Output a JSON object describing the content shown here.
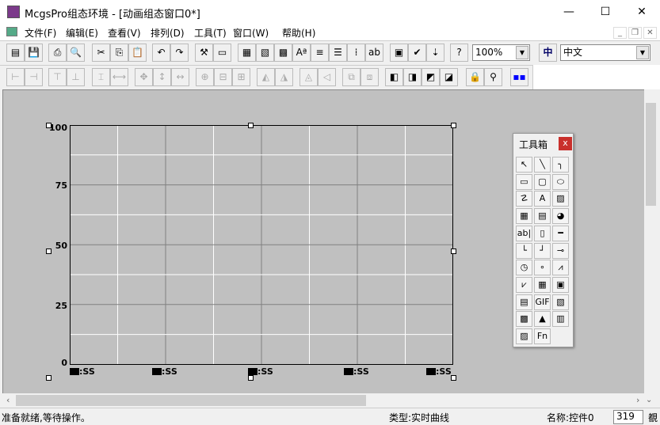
{
  "window": {
    "title": "McgsPro组态环境 - [动画组态窗口0*]",
    "min": "—",
    "max": "☐",
    "close": "✕"
  },
  "menu": [
    "文件(F)",
    "编辑(E)",
    "查看(V)",
    "排列(D)",
    "工具(T)",
    "窗口(W)",
    "帮助(H)"
  ],
  "mdi_controls": [
    "_",
    "❐",
    "✕"
  ],
  "toolbar1": {
    "buttons": [
      {
        "name": "new-window",
        "glyph": "▤"
      },
      {
        "name": "save",
        "glyph": "💾"
      },
      {
        "name": "print",
        "glyph": "⎙"
      },
      {
        "name": "print-preview",
        "glyph": "🔍"
      },
      {
        "name": "cut",
        "glyph": "✂"
      },
      {
        "name": "copy",
        "glyph": "⎘"
      },
      {
        "name": "paste",
        "glyph": "📋"
      },
      {
        "name": "undo",
        "glyph": "↶"
      },
      {
        "name": "redo",
        "glyph": "↷"
      },
      {
        "name": "toolbox",
        "glyph": "⚒"
      },
      {
        "name": "frame",
        "glyph": "▭"
      },
      {
        "name": "fill-color",
        "glyph": "▦"
      },
      {
        "name": "line-color",
        "glyph": "▧"
      },
      {
        "name": "font-color",
        "glyph": "▩"
      },
      {
        "name": "font",
        "glyph": "Aª"
      },
      {
        "name": "line-style",
        "glyph": "≡"
      },
      {
        "name": "align-text",
        "glyph": "☰"
      },
      {
        "name": "grid",
        "glyph": "⁞"
      },
      {
        "name": "text-edit",
        "glyph": "ab"
      },
      {
        "name": "properties",
        "glyph": "▣"
      },
      {
        "name": "check",
        "glyph": "✔"
      },
      {
        "name": "order",
        "glyph": "⇣"
      },
      {
        "name": "help",
        "glyph": "?"
      }
    ],
    "zoom": "100%",
    "lang_icon": "中",
    "language": "中文"
  },
  "toolbar2": {
    "buttons": [
      {
        "name": "align-left",
        "glyph": "⊢"
      },
      {
        "name": "align-right",
        "glyph": "⊣"
      },
      {
        "name": "align-top",
        "glyph": "⊤"
      },
      {
        "name": "align-bottom",
        "glyph": "⊥"
      },
      {
        "name": "center-v",
        "glyph": "⌶"
      },
      {
        "name": "center-h",
        "glyph": "⟷"
      },
      {
        "name": "same-size",
        "glyph": "✥"
      },
      {
        "name": "same-height",
        "glyph": "↕"
      },
      {
        "name": "same-width",
        "glyph": "↔"
      },
      {
        "name": "center-both",
        "glyph": "⊕"
      },
      {
        "name": "center-horiz",
        "glyph": "⊟"
      },
      {
        "name": "center-vert",
        "glyph": "⊞"
      },
      {
        "name": "rotate-left",
        "glyph": "◭"
      },
      {
        "name": "rotate-right",
        "glyph": "◮"
      },
      {
        "name": "flip-h",
        "glyph": "◬"
      },
      {
        "name": "flip-v",
        "glyph": "◁"
      },
      {
        "name": "group",
        "glyph": "⧉"
      },
      {
        "name": "ungroup",
        "glyph": "⧈"
      }
    ],
    "active": [
      {
        "name": "bring-front",
        "glyph": "◧"
      },
      {
        "name": "send-back",
        "glyph": "◨"
      },
      {
        "name": "forward",
        "glyph": "◩"
      },
      {
        "name": "backward",
        "glyph": "◪"
      },
      {
        "name": "lock",
        "glyph": "🔒"
      },
      {
        "name": "anchor",
        "glyph": "⚲"
      },
      {
        "name": "palette",
        "glyph": "▪▪"
      }
    ]
  },
  "chart": {
    "y_ticks": [
      "100",
      "75",
      "50",
      "25",
      "0"
    ],
    "x_ticks": [
      ":SS",
      ":SS",
      ":SS",
      ":SS",
      ":SS"
    ]
  },
  "toolbox": {
    "title": "工具箱",
    "close": "x",
    "tools": [
      "↖",
      "╲",
      "╮",
      "▭",
      "▢",
      "⬭",
      "☡",
      "A",
      "▨",
      "▦",
      "▤",
      "◕",
      "ab|",
      "▯",
      "━",
      "└",
      "┘",
      "⊸",
      "◷",
      "∘",
      "⩘",
      "⩗",
      "▦",
      "▣",
      "▤",
      "GIF",
      "▧",
      "▩",
      "▲",
      "▥",
      "▨",
      "Fn"
    ]
  },
  "status": {
    "message": "准备就绪,等待操作。",
    "type": "类型:实时曲线",
    "name": "名称:控件0",
    "value": "319",
    "extra": "覩"
  }
}
